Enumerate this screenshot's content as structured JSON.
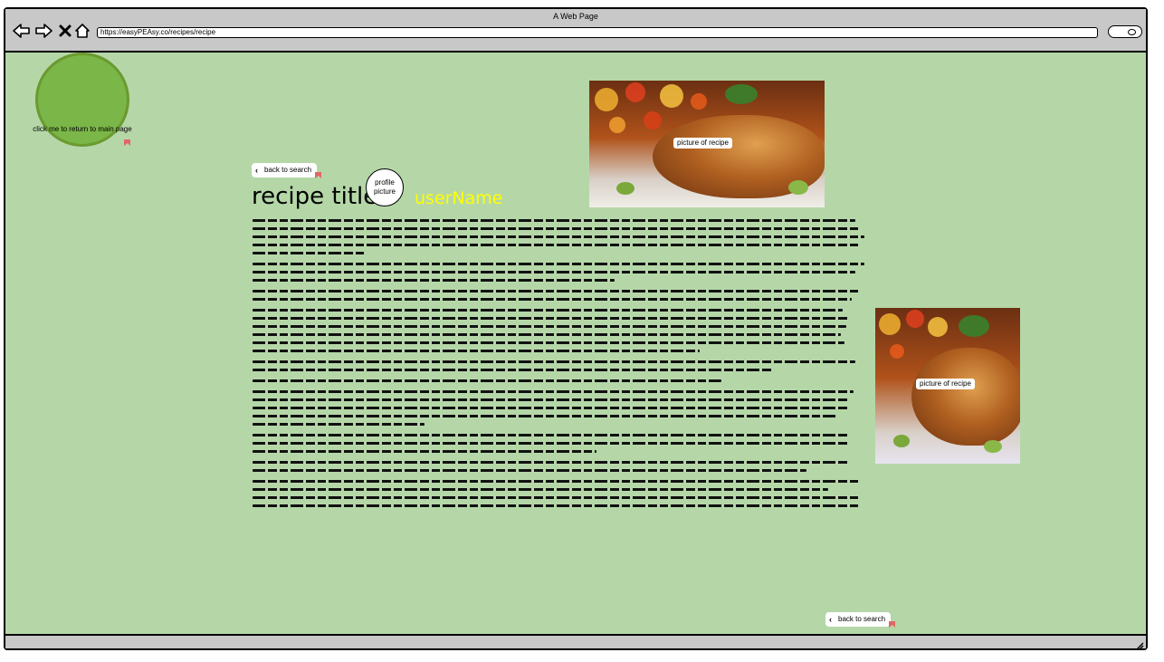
{
  "window": {
    "title": "A Web Page"
  },
  "toolbar": {
    "url": "https://easyPEAsy.co/recipes/recipe"
  },
  "home": {
    "label": "click me to return to main page"
  },
  "back_to_search": {
    "top_label": "back to search",
    "bottom_label": "back to search"
  },
  "recipe": {
    "title": "recipe title",
    "profile_picture_label": "profile picture",
    "username": "userName",
    "image_top_label": "picture of recipe",
    "image_side_label": "picture of recipe"
  },
  "colors": {
    "background": "#b5d7a8",
    "home_circle": "#7ab648",
    "username": "#ffff00",
    "chrome": "#c8c8c8"
  },
  "icons": [
    "back-arrow-icon",
    "forward-arrow-icon",
    "close-icon",
    "home-icon",
    "search-icon",
    "link-flag-icon",
    "chevron-left-icon",
    "resize-grip-icon"
  ]
}
